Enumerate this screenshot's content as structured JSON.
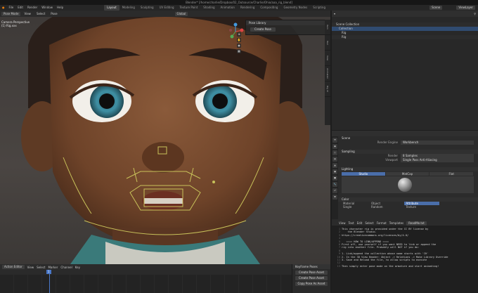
{
  "title_bar": "Blender* [/home/charlie/Dropbox/02_Outsource/Charlie/Ohio/aaa_rig_blend]",
  "menu": [
    "File",
    "Edit",
    "Render",
    "Window",
    "Help"
  ],
  "workspaces": [
    "Layout",
    "Modeling",
    "Sculpting",
    "UV Editing",
    "Texture Paint",
    "Shading",
    "Animation",
    "Rendering",
    "Compositing",
    "Geometry Nodes",
    "Scripting"
  ],
  "active_workspace": "Layout",
  "scene_label": "Scene",
  "view_layer_label": "ViewLayer",
  "viewport": {
    "mode": "Pose Mode",
    "menus": [
      "View",
      "Select",
      "Pose"
    ],
    "orientation": "Global",
    "overlay_info": [
      "Camera Perspective",
      "(1) Rig.xxx"
    ],
    "pose_panel_title": "Pose Library",
    "pose_panel_button": "Create Pose",
    "npanel_tabs": [
      "Item",
      "Tool",
      "View",
      "Animation",
      "Rig UI"
    ]
  },
  "outliner": {
    "rows": [
      {
        "label": "Scene Collection",
        "sel": false
      },
      {
        "label": "Collection",
        "sel": true
      },
      {
        "label": "Rig",
        "sel": false
      },
      {
        "label": "Rig",
        "sel": false
      }
    ]
  },
  "properties": {
    "section": "Scene",
    "render_engine_label": "Render Engine",
    "render_engine_value": "Workbench",
    "sampling": "Sampling",
    "sampling_rows": [
      {
        "label": "Render",
        "value": "8 Samples"
      },
      {
        "label": "Viewport",
        "value": "Single Pass Anti-Aliasing"
      }
    ],
    "lighting": "Lighting",
    "lighting_tabs": [
      "Studio",
      "MatCap",
      "Flat"
    ],
    "lighting_active": "Studio",
    "color": "Color",
    "color_options": [
      "Material",
      "Object",
      "Attribute",
      "Single",
      "Random",
      "Texture"
    ],
    "color_active": "Attribute"
  },
  "text_editor": {
    "menus": [
      "View",
      "Text",
      "Edit",
      "Select",
      "Format",
      "Templates"
    ],
    "filename": "ReadMe.txt",
    "lines": [
      "This character rig is provided under the CC BY license by",
      "    the Blender Studio.",
      "https://creativecommons.org/licenses/by/4.0/",
      "",
      "   ==== HOW TO LINK/APPEND ====",
      "First off, use yourself if you want NEED to link or append the",
      "rig into another file. Probably will NOT if you do:",
      "",
      "1. Link/append the collection whose name starts with 'CH'",
      "2. In the 3D View Header: Object -> Relations -> Make Library Override",
      "3. Save and Reload the file, to allow scripts to execute",
      "",
      "Then simply enter pose mode on the armature and start animating!"
    ],
    "line_numbers": [
      "1",
      "2",
      "3",
      "4",
      "5",
      "6",
      "7",
      "8",
      "9",
      "10",
      "11",
      "12",
      "13"
    ]
  },
  "timeline": {
    "menus": [
      "Action Editor",
      "View",
      "Select",
      "Marker",
      "Channel",
      "Key"
    ],
    "current_frame": "1",
    "dope_panel_title": "Keyframe Poses",
    "dope_buttons": [
      "Create Pose Asset",
      "Create Pose Asset",
      "Copy Pose As Asset"
    ]
  }
}
